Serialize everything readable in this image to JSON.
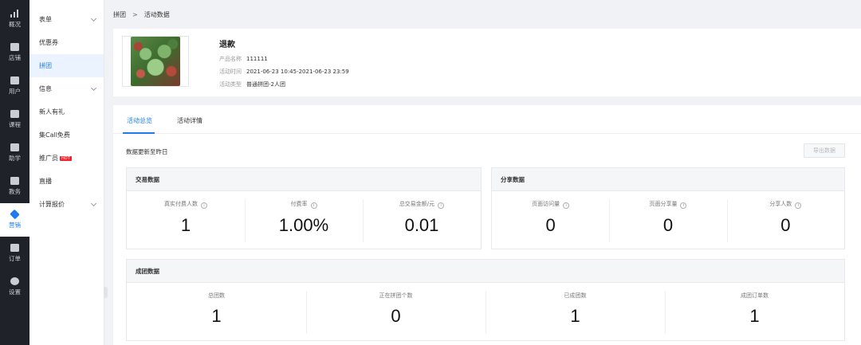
{
  "rail": [
    {
      "label": "概况",
      "icon": "bar-chart-icon"
    },
    {
      "label": "店铺",
      "icon": "store-icon"
    },
    {
      "label": "用户",
      "icon": "users-icon"
    },
    {
      "label": "课程",
      "icon": "book-icon"
    },
    {
      "label": "助学",
      "icon": "assist-icon"
    },
    {
      "label": "教务",
      "icon": "clipboard-icon"
    },
    {
      "label": "营销",
      "icon": "tag-icon"
    },
    {
      "label": "订单",
      "icon": "order-icon"
    },
    {
      "label": "设置",
      "icon": "gear-icon"
    }
  ],
  "menu": [
    {
      "label": "表单",
      "chevron": true
    },
    {
      "label": "优惠券"
    },
    {
      "label": "拼团",
      "active": true
    },
    {
      "label": "信息",
      "chevron": true
    },
    {
      "label": "新人有礼"
    },
    {
      "label": "集Call免费"
    },
    {
      "label": "推广员",
      "badge": "HOT"
    },
    {
      "label": "直播"
    },
    {
      "label": "计算报价",
      "chevron": true
    }
  ],
  "breadcrumb": {
    "parent": "拼团",
    "separator": ">",
    "current": "活动数据"
  },
  "product": {
    "name": "退款",
    "info": [
      {
        "key": "产品名称",
        "value": "111111"
      },
      {
        "key": "活动时间",
        "value": "2021-06-23 10:45-2021-06-23 23:59"
      },
      {
        "key": "活动类型",
        "value": "普通拼团-2人团"
      }
    ]
  },
  "tabs": [
    {
      "label": "活动总览",
      "active": true
    },
    {
      "label": "活动详情"
    }
  ],
  "update_note": "数据更新至昨日",
  "export_label": "导出数据",
  "trade": {
    "title": "交易数据",
    "metrics": [
      {
        "label": "真实付费人数",
        "value": "1"
      },
      {
        "label": "付费率",
        "value": "1.00%"
      },
      {
        "label": "总交易金额/元",
        "value": "0.01"
      }
    ]
  },
  "share": {
    "title": "分享数据",
    "metrics": [
      {
        "label": "页面访问量",
        "value": "0"
      },
      {
        "label": "页面分享量",
        "value": "0"
      },
      {
        "label": "分享人数",
        "value": "0"
      }
    ]
  },
  "group": {
    "title": "成团数据",
    "metrics": [
      {
        "label": "总团数",
        "value": "1"
      },
      {
        "label": "正在拼团个数",
        "value": "0"
      },
      {
        "label": "已成团数",
        "value": "1"
      },
      {
        "label": "成团订单数",
        "value": "1"
      }
    ]
  },
  "colors": {
    "accent": "#1e7bf0",
    "rail_bg": "#1f2329",
    "hot_badge": "#f5222d"
  }
}
